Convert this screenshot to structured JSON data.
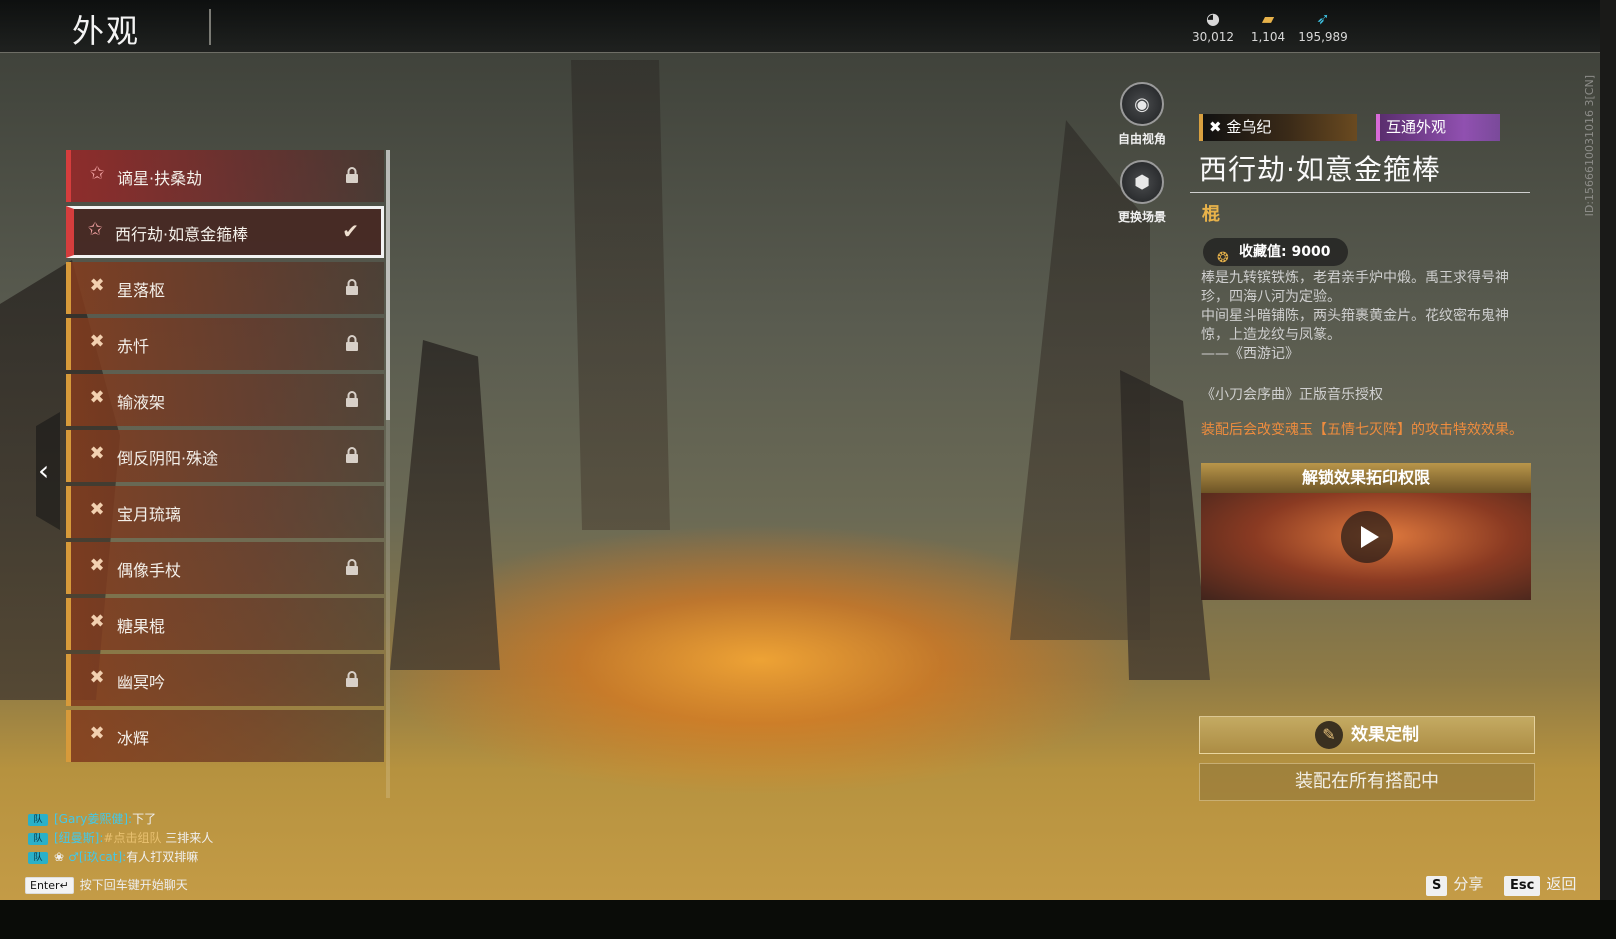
{
  "header": {
    "title": "外观",
    "currencies": [
      {
        "icon": "coin-icon",
        "value": "30,012"
      },
      {
        "icon": "ticket-icon",
        "value": "1,104"
      },
      {
        "icon": "feather-icon",
        "value": "195,989"
      }
    ]
  },
  "uid": "ID:1566610031016 3[CN]",
  "list": {
    "items": [
      {
        "label": "谪星·扶桑劫",
        "locked": true,
        "selected": false
      },
      {
        "label": "西行劫·如意金箍棒",
        "locked": false,
        "selected": true
      },
      {
        "label": "星落枢",
        "locked": true,
        "selected": false
      },
      {
        "label": "赤忏",
        "locked": true,
        "selected": false
      },
      {
        "label": "输液架",
        "locked": true,
        "selected": false
      },
      {
        "label": "倒反阴阳·殊途",
        "locked": true,
        "selected": false
      },
      {
        "label": "宝月琉璃",
        "locked": false,
        "selected": false
      },
      {
        "label": "偶像手杖",
        "locked": true,
        "selected": false
      },
      {
        "label": "糖果棍",
        "locked": false,
        "selected": false
      },
      {
        "label": "幽冥吟",
        "locked": true,
        "selected": false
      },
      {
        "label": "冰辉",
        "locked": false,
        "selected": false
      }
    ]
  },
  "view_buttons": {
    "free_view": "自由视角",
    "change_scene": "更换场景"
  },
  "detail": {
    "tag_series": "金乌纪",
    "tag_shared": "互通外观",
    "name": "西行劫·如意金箍棒",
    "type": "棍",
    "collection_label": "收藏值: 9000",
    "description": [
      "棒是九转镔铁炼，老君亲手炉中煅。禹王求得号神珍，四海八河为定验。",
      "中间星斗暗铺陈，两头箝裹黄金片。花纹密布鬼神惊，上造龙纹与凤篆。",
      "——《西游记》"
    ],
    "music": "《小刀会序曲》正版音乐授权",
    "effect_note": "装配后会改变魂玉【五情七灭阵】的攻击特效效果。",
    "unlock_title": "解锁效果拓印权限",
    "customize_button": "效果定制",
    "equip_button": "装配在所有搭配中"
  },
  "chat": {
    "lines": [
      {
        "name": "[Gary姜熙健]:",
        "text": "下了",
        "link": ""
      },
      {
        "name": "[纽曼斯]:",
        "text": " 三排来人",
        "link": "#点击组队"
      },
      {
        "name": "♂[i玖cat]:",
        "text": "有人打双排嘛",
        "link": ""
      }
    ],
    "enter_key": "Enter↵",
    "enter_hint": "按下回车键开始聊天"
  },
  "footer": {
    "share_key": "S",
    "share_label": "分享",
    "back_key": "Esc",
    "back_label": "返回"
  }
}
